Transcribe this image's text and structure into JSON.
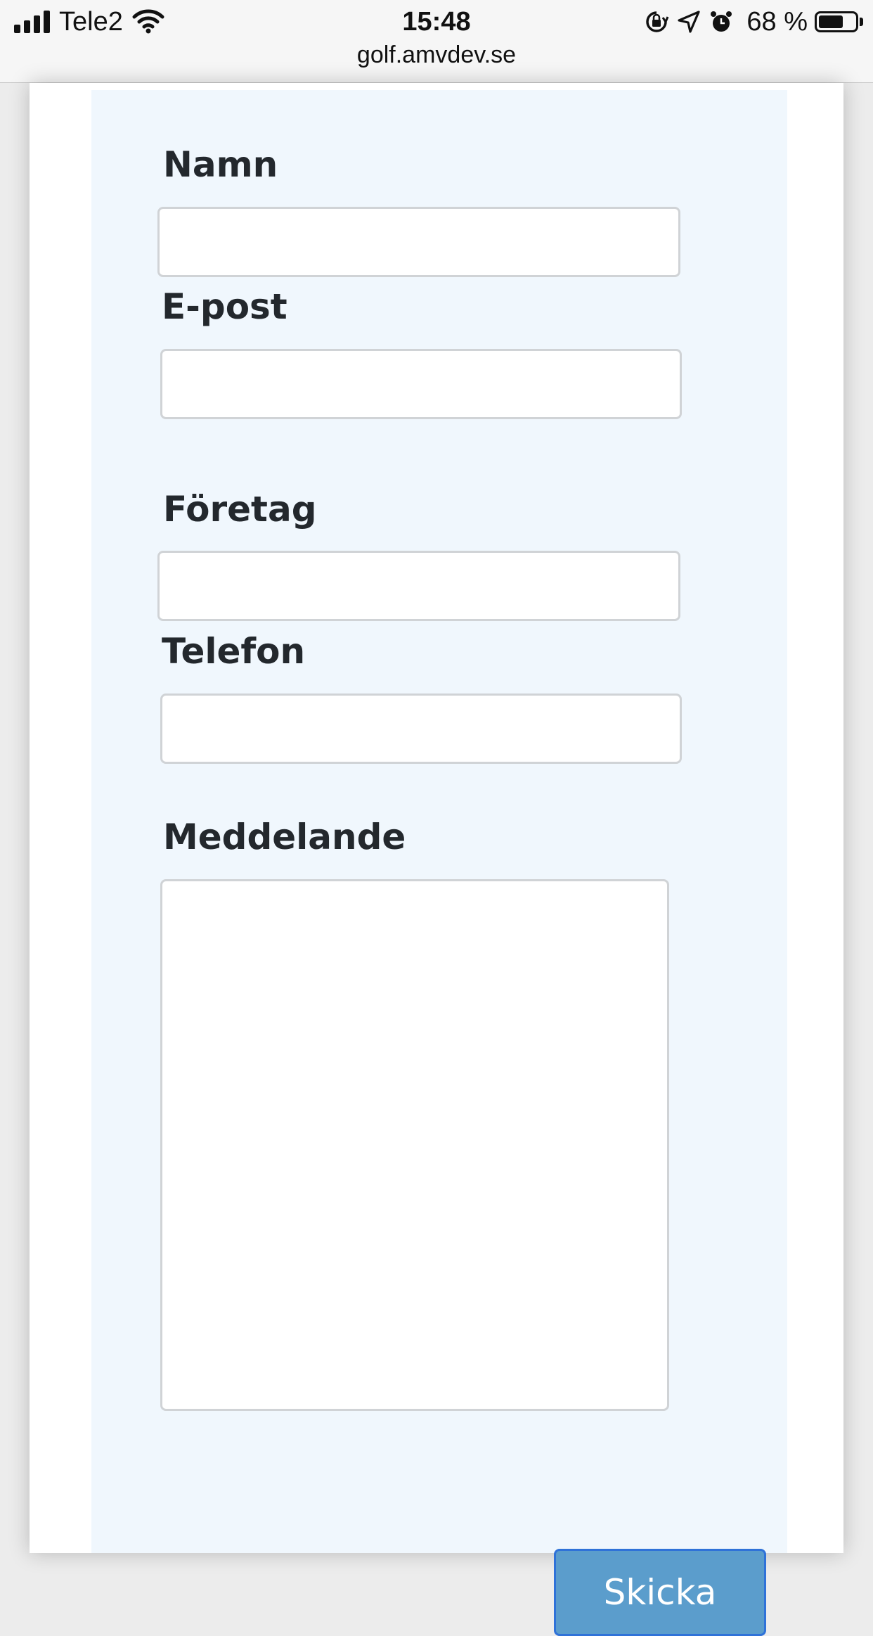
{
  "status_bar": {
    "carrier": "Tele2",
    "time": "15:48",
    "battery_percent": "68 %",
    "battery_level": 0.68,
    "icons": [
      "signal-icon",
      "wifi-icon",
      "orientation-lock-icon",
      "location-arrow-icon",
      "alarm-icon",
      "battery-icon"
    ]
  },
  "browser": {
    "url": "golf.amvdev.se"
  },
  "form": {
    "fields": {
      "name": {
        "label": "Namn",
        "value": ""
      },
      "email": {
        "label": "E-post",
        "value": ""
      },
      "company": {
        "label": "Företag",
        "value": ""
      },
      "phone": {
        "label": "Telefon",
        "value": ""
      },
      "message": {
        "label": "Meddelande",
        "value": ""
      }
    },
    "submit_label": "Skicka"
  },
  "colors": {
    "form_background": "#f0f7fd",
    "label_text": "#23282d",
    "input_border": "#d0d3d6",
    "submit_background": "#5b9dcc",
    "submit_border": "#2f72d8",
    "submit_text": "#ffffff"
  }
}
